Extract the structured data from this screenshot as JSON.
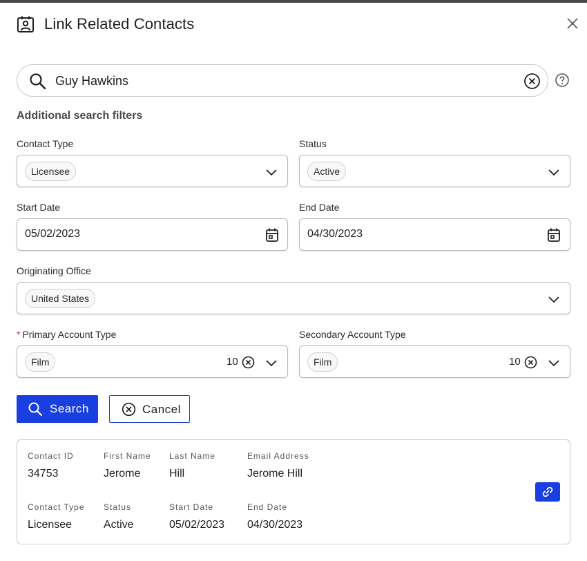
{
  "dialog": {
    "title": "Link Related Contacts",
    "header_icon": "contact-card-icon",
    "close_icon": "close-icon"
  },
  "search": {
    "value": "Guy Hawkins",
    "placeholder": "",
    "clear_icon": "clear-circle-icon",
    "help_icon": "help-circle-icon"
  },
  "filters": {
    "section_title": "Additional search filters",
    "contact_type": {
      "label": "Contact Type",
      "value": "Licensee"
    },
    "status": {
      "label": "Status",
      "value": "Active"
    },
    "start_date": {
      "label": "Start Date",
      "value": "05/02/2023"
    },
    "end_date": {
      "label": "End Date",
      "value": "04/30/2023"
    },
    "originating_office": {
      "label": "Originating Office",
      "value": "United States"
    },
    "primary_account_type": {
      "label": "Primary Account Type",
      "required_mark": "*",
      "value": "Film",
      "count": "10"
    },
    "secondary_account_type": {
      "label": "Secondary Account Type",
      "value": "Film",
      "count": "10"
    }
  },
  "actions": {
    "search_label": "Search",
    "cancel_label": "Cancel"
  },
  "result": {
    "headers": {
      "contact_id": "Contact ID",
      "first_name": "First Name",
      "last_name": "Last Name",
      "email": "Email Address",
      "contact_type": "Contact Type",
      "status": "Status",
      "start_date": "Start Date",
      "end_date": "End Date"
    },
    "values": {
      "contact_id": "34753",
      "first_name": "Jerome",
      "last_name": "Hill",
      "email": "Jerome Hill",
      "contact_type": "Licensee",
      "status": "Active",
      "start_date": "05/02/2023",
      "end_date": "04/30/2023"
    },
    "link_icon": "link-icon"
  },
  "colors": {
    "primary": "#1a3fe0",
    "required": "#d0255c",
    "border": "#b8b8b8"
  }
}
